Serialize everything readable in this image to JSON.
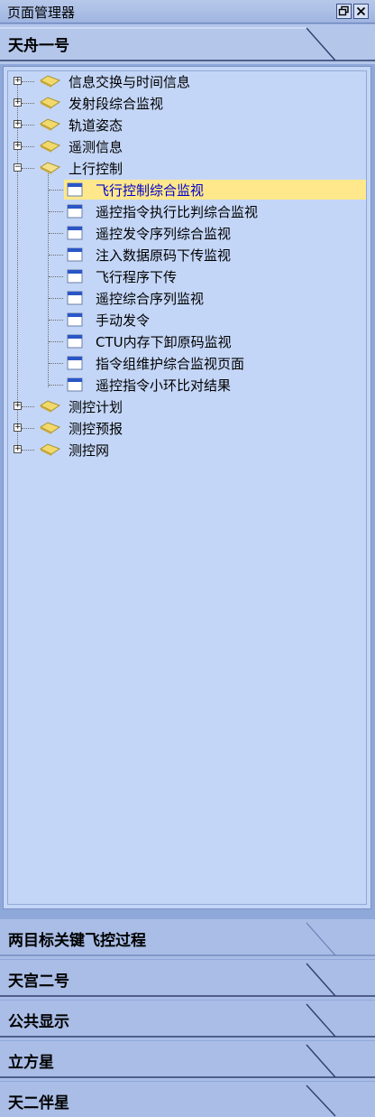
{
  "window": {
    "title": "页面管理器",
    "restore_icon": "restore-icon",
    "close_icon": "close-icon"
  },
  "sections": {
    "active": "天舟一号",
    "others": [
      "两目标关键飞控过程",
      "天宫二号",
      "公共显示",
      "立方星",
      "天二伴星"
    ]
  },
  "tree": {
    "folders_before": [
      {
        "label": "信息交换与时间信息",
        "expander": "+"
      },
      {
        "label": "发射段综合监视",
        "expander": "+"
      },
      {
        "label": "轨道姿态",
        "expander": "+"
      },
      {
        "label": "遥测信息",
        "expander": "+"
      },
      {
        "label": "上行控制",
        "expander": "−"
      }
    ],
    "children": [
      {
        "label": "飞行控制综合监视"
      },
      {
        "label": "遥控指令执行比判综合监视"
      },
      {
        "label": "遥控发令序列综合监视"
      },
      {
        "label": "注入数据原码下传监视"
      },
      {
        "label": "飞行程序下传"
      },
      {
        "label": "遥控综合序列监视"
      },
      {
        "label": "手动发令"
      },
      {
        "label": "CTU内存下卸原码监视"
      },
      {
        "label": "指令组维护综合监视页面"
      },
      {
        "label": "遥控指令小环比对结果"
      }
    ],
    "folders_after": [
      {
        "label": "测控计划",
        "expander": "+"
      },
      {
        "label": "测控预报",
        "expander": "+"
      },
      {
        "label": "测控网",
        "expander": "+"
      }
    ],
    "selected_index": 0
  },
  "colors": {
    "selection": "#ffe88b",
    "selected_text": "#0000cc",
    "panel": "#c4d6f7",
    "header": "#b4c6ea"
  }
}
